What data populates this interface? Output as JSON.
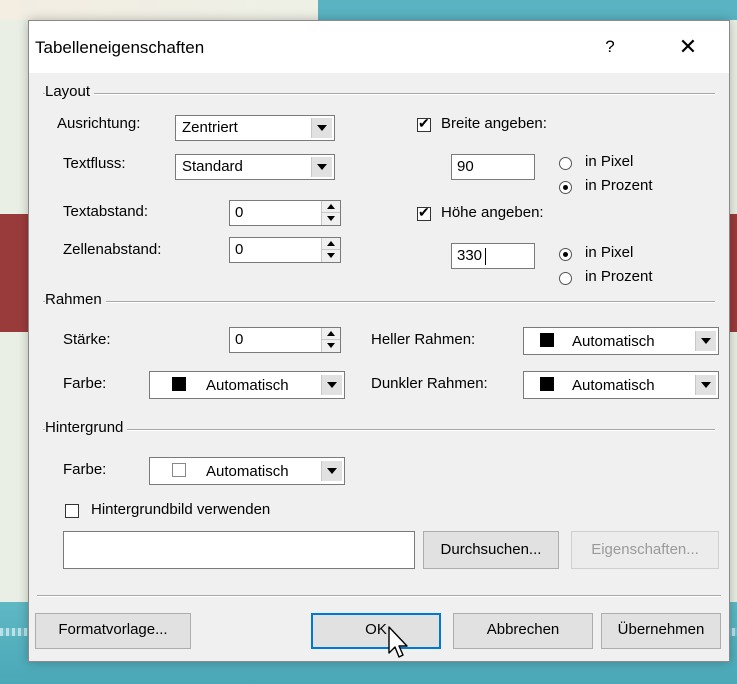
{
  "dialog": {
    "title": "Tabelleneigenschaften",
    "help": "?",
    "close": "✕"
  },
  "layout": {
    "group": "Layout",
    "alignment_label": "Ausrichtung:",
    "alignment_value": "Zentriert",
    "textflow_label": "Textfluss:",
    "textflow_value": "Standard",
    "textspacing_label": "Textabstand:",
    "textspacing_value": "0",
    "cellspacing_label": "Zellenabstand:",
    "cellspacing_value": "0",
    "width_check": "Breite angeben:",
    "width_checked": true,
    "width_value": "90",
    "width_pixel": "in Pixel",
    "width_percent": "in Prozent",
    "width_unit_selected": "in Prozent",
    "height_check": "Höhe angeben:",
    "height_checked": true,
    "height_value": "330",
    "height_pixel": "in Pixel",
    "height_percent": "in Prozent",
    "height_unit_selected": "in Pixel"
  },
  "border": {
    "group": "Rahmen",
    "strength_label": "Stärke:",
    "strength_value": "0",
    "color_label": "Farbe:",
    "color_value": "Automatisch",
    "light_label": "Heller Rahmen:",
    "light_value": "Automatisch",
    "dark_label": "Dunkler Rahmen:",
    "dark_value": "Automatisch"
  },
  "background": {
    "group": "Hintergrund",
    "color_label": "Farbe:",
    "color_value": "Automatisch",
    "image_check": "Hintergrundbild verwenden",
    "image_checked": false,
    "image_path": "",
    "browse": "Durchsuchen...",
    "properties": "Eigenschaften..."
  },
  "footer": {
    "style": "Formatvorlage...",
    "ok": "OK",
    "cancel": "Abbrechen",
    "apply": "Übernehmen"
  },
  "colors": {
    "swatch_black": "#000000",
    "swatch_white": "#ffffff"
  }
}
